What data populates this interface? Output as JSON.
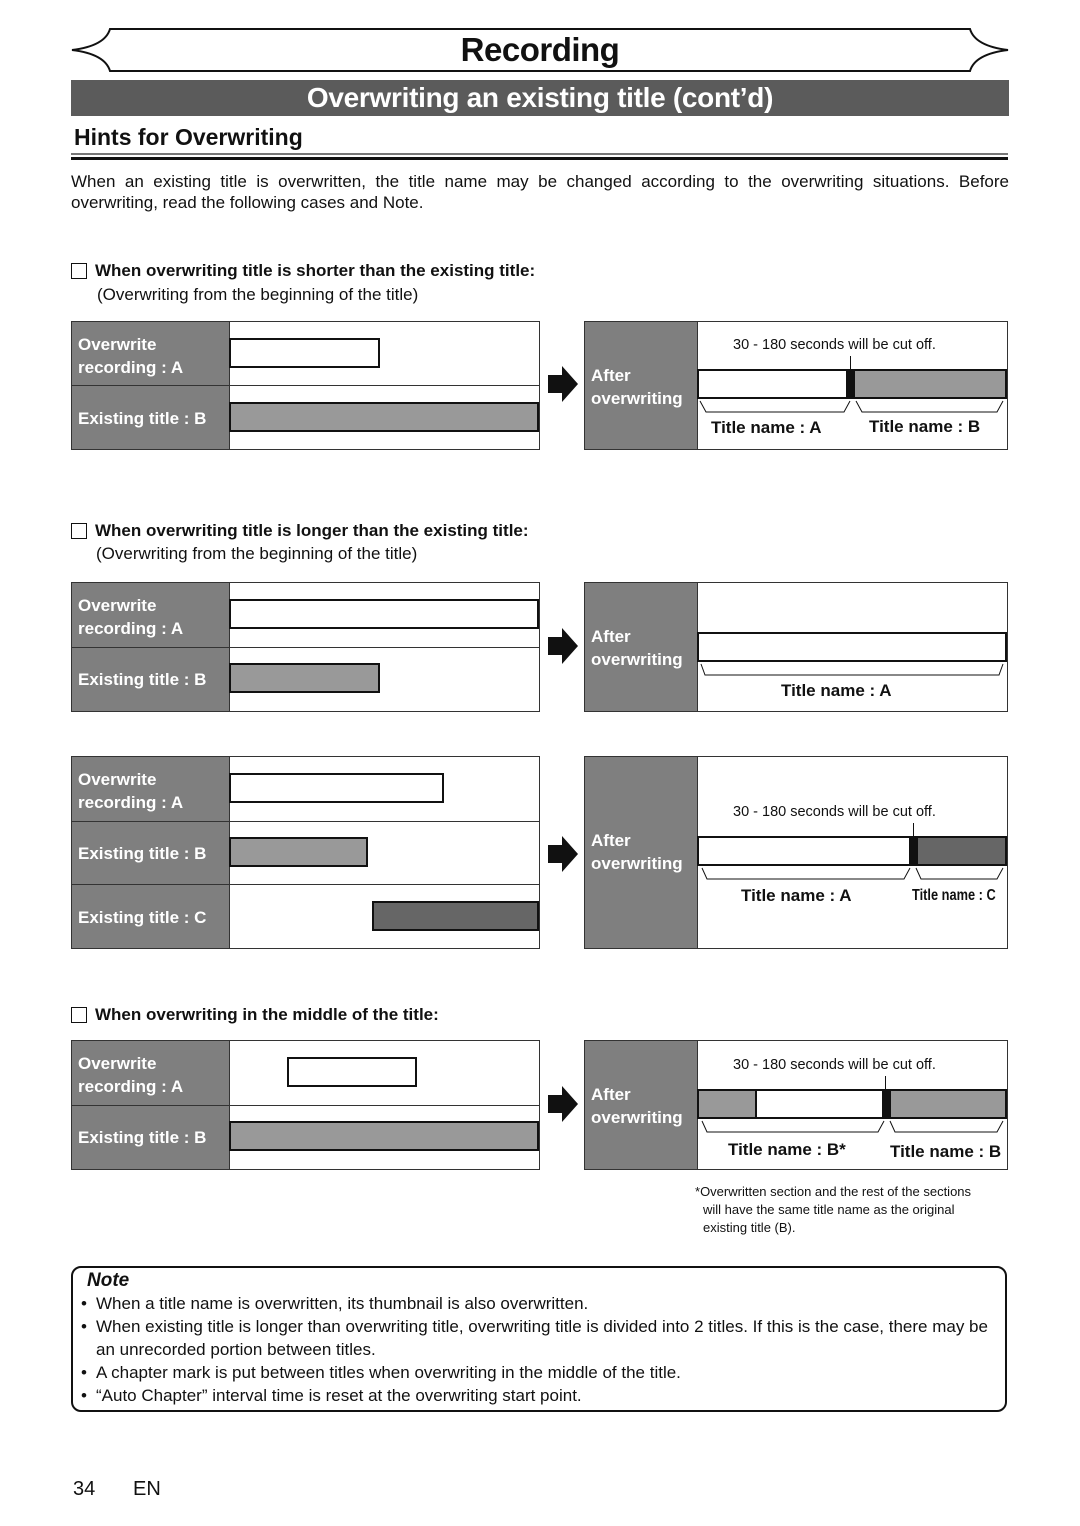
{
  "header": {
    "chapter_title": "Recording",
    "section_title": "Overwriting an existing title (cont’d)",
    "subsection_title": "Hints for Overwriting"
  },
  "intro": "When an existing title is overwritten, the title name may be changed according to the overwriting situations. Before overwriting, read the following cases and Note.",
  "cases": [
    {
      "heading": "When overwriting title is shorter than the existing title:",
      "subheading": "(Overwriting from the beginning of the title)",
      "before": {
        "rows": [
          {
            "label_line1": "Overwrite",
            "label_line2": "recording : A"
          },
          {
            "label_line1": "Existing title : B",
            "label_line2": ""
          }
        ]
      },
      "after": {
        "label_line1": "After",
        "label_line2": "overwriting",
        "cut_note": "30 - 180 seconds will be cut off.",
        "title_names": [
          "Title name : A",
          "Title name : B"
        ]
      }
    },
    {
      "heading": "When overwriting title is longer than the existing title:",
      "subheading": "(Overwriting from the beginning of the title)",
      "before": {
        "rows": [
          {
            "label_line1": "Overwrite",
            "label_line2": "recording : A"
          },
          {
            "label_line1": "Existing title : B",
            "label_line2": ""
          }
        ]
      },
      "after": {
        "label_line1": "After",
        "label_line2": "overwriting",
        "title_names": [
          "Title name : A"
        ]
      }
    },
    {
      "heading": "",
      "subheading": "",
      "before": {
        "rows": [
          {
            "label_line1": "Overwrite",
            "label_line2": "recording : A"
          },
          {
            "label_line1": "Existing title : B",
            "label_line2": ""
          },
          {
            "label_line1": "Existing title : C",
            "label_line2": ""
          }
        ]
      },
      "after": {
        "label_line1": "After",
        "label_line2": "overwriting",
        "cut_note": "30 - 180 seconds will be cut off.",
        "title_names": [
          "Title name : A",
          "Title name : C"
        ]
      }
    },
    {
      "heading": "When overwriting in the middle of the title:",
      "subheading": "",
      "before": {
        "rows": [
          {
            "label_line1": "Overwrite",
            "label_line2": "recording : A"
          },
          {
            "label_line1": "Existing title : B",
            "label_line2": ""
          }
        ]
      },
      "after": {
        "label_line1": "After",
        "label_line2": "overwriting",
        "cut_note": "30 - 180 seconds will be cut off.",
        "title_names": [
          "Title name : B*",
          "Title name : B"
        ]
      }
    }
  ],
  "footnote": {
    "marker": "*",
    "line1": "Overwritten section and the rest of the sections",
    "line2": "will have the same title name as the original",
    "line3": "existing title (B)."
  },
  "note": {
    "title": "Note",
    "items": [
      "When a title name is overwritten, its thumbnail is also overwritten.",
      "When existing title is longer than overwriting title, overwriting title is divided into 2 titles. If this is the case, there may be an unrecorded portion between titles.",
      "A chapter mark is put between titles when overwriting in the middle of the title.",
      "“Auto Chapter” interval time is reset at the overwriting start point."
    ]
  },
  "footer": {
    "page_number": "34",
    "language": "EN"
  }
}
